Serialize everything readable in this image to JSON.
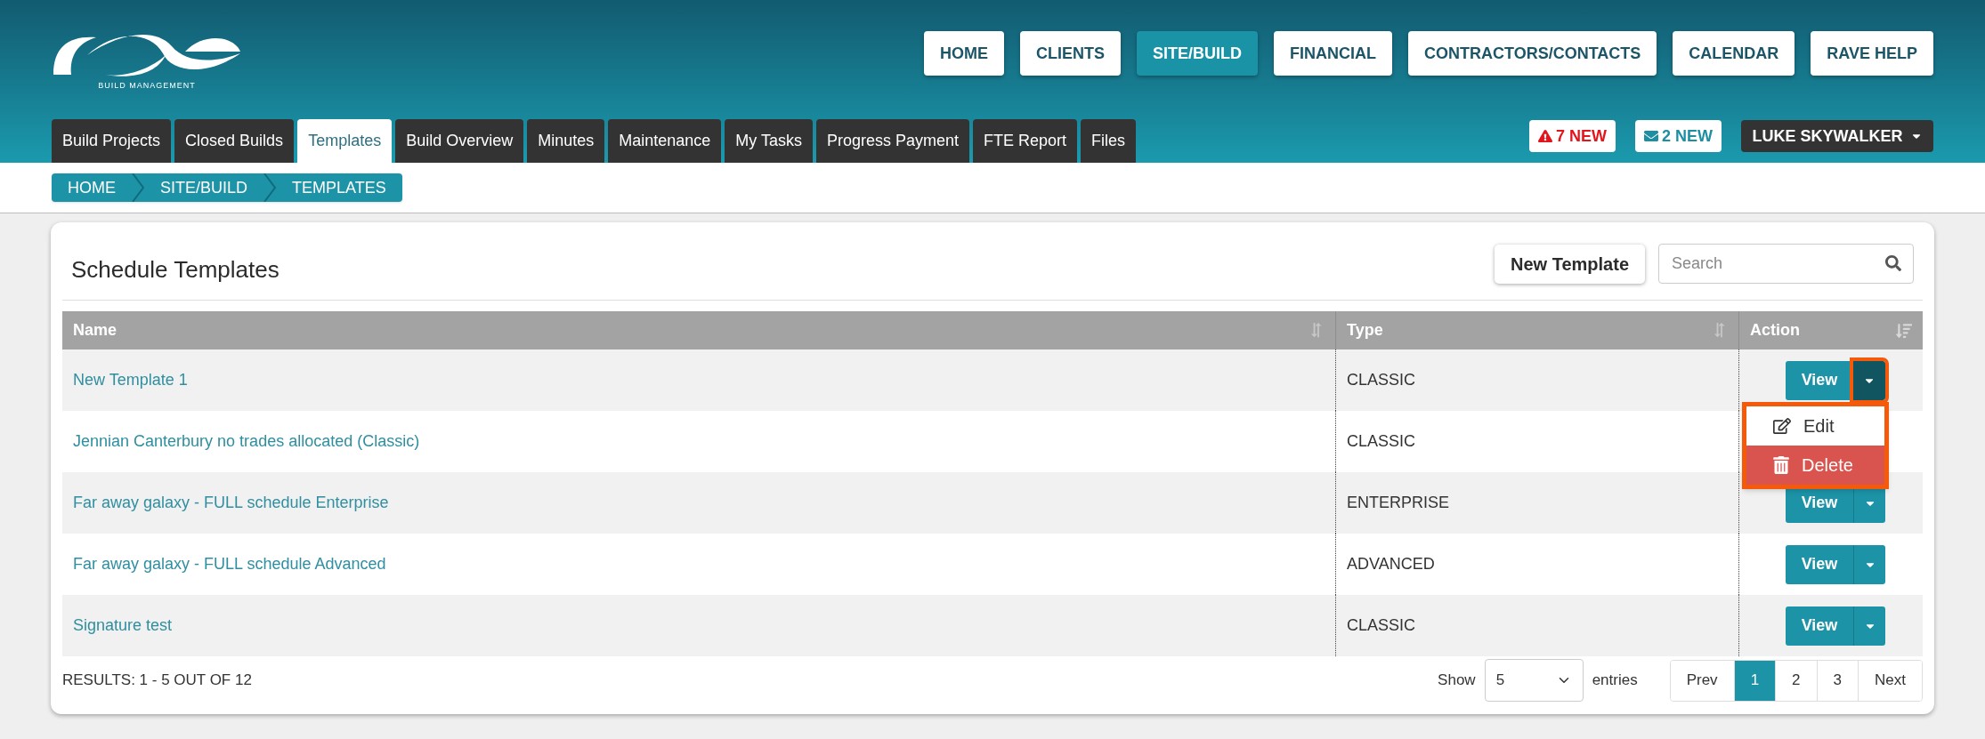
{
  "logo": {
    "tagline": "BUILD MANAGEMENT"
  },
  "main_nav": [
    {
      "label": "HOME",
      "selected": false
    },
    {
      "label": "CLIENTS",
      "selected": false
    },
    {
      "label": "SITE/BUILD",
      "selected": true
    },
    {
      "label": "FINANCIAL",
      "selected": false
    },
    {
      "label": "CONTRACTORS/CONTACTS",
      "selected": false
    },
    {
      "label": "CALENDAR",
      "selected": false
    },
    {
      "label": "RAVE HELP",
      "selected": false
    }
  ],
  "tabs": [
    {
      "label": "Build Projects",
      "selected": false
    },
    {
      "label": "Closed Builds",
      "selected": false
    },
    {
      "label": "Templates",
      "selected": true
    },
    {
      "label": "Build Overview",
      "selected": false
    },
    {
      "label": "Minutes",
      "selected": false
    },
    {
      "label": "Maintenance",
      "selected": false
    },
    {
      "label": "My Tasks",
      "selected": false
    },
    {
      "label": "Progress Payment",
      "selected": false
    },
    {
      "label": "FTE Report",
      "selected": false
    },
    {
      "label": "Files",
      "selected": false
    }
  ],
  "notifications": [
    {
      "kind": "alert",
      "label": "7 NEW"
    },
    {
      "kind": "mail",
      "label": "2 NEW"
    }
  ],
  "user_menu": {
    "label": "LUKE SKYWALKER"
  },
  "breadcrumb": [
    "HOME",
    "SITE/BUILD",
    "TEMPLATES"
  ],
  "card": {
    "title": "Schedule Templates",
    "new_button": "New Template",
    "search": {
      "placeholder": "Search"
    },
    "table": {
      "columns": [
        {
          "label": "Name",
          "kind": "sortable"
        },
        {
          "label": "Type",
          "kind": "sortable"
        },
        {
          "label": "Action",
          "kind": "sorted"
        }
      ],
      "rows": [
        {
          "name": "New Template 1",
          "type": "CLASSIC",
          "action": "View",
          "menu_open": true
        },
        {
          "name": "Jennian Canterbury no trades allocated (Classic)",
          "type": "CLASSIC",
          "menu_open": false
        },
        {
          "name": "Far away galaxy - FULL schedule Enterprise",
          "type": "ENTERPRISE",
          "action": "View",
          "menu_open": false
        },
        {
          "name": "Far away galaxy - FULL schedule Advanced",
          "type": "ADVANCED",
          "action": "View",
          "menu_open": false
        },
        {
          "name": "Signature test",
          "type": "CLASSIC",
          "action": "View",
          "menu_open": false
        }
      ]
    },
    "action_menu": [
      {
        "kind": "edit",
        "label": "Edit"
      },
      {
        "kind": "delete",
        "label": "Delete"
      }
    ],
    "results": "RESULTS: 1 - 5 OUT OF 12",
    "show_label": "Show",
    "page_size": "5",
    "entries_label": "entries",
    "pagination": [
      {
        "label": "Prev",
        "selected": false
      },
      {
        "label": "1",
        "selected": true
      },
      {
        "label": "2",
        "selected": false
      },
      {
        "label": "3",
        "selected": false
      },
      {
        "label": "Next",
        "selected": false
      }
    ]
  }
}
